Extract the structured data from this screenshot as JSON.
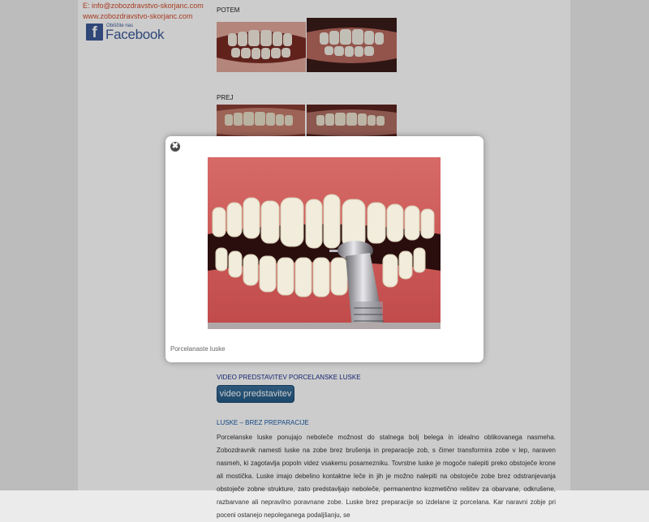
{
  "sidebar": {
    "email": "E: info@zobozdravstvo-skorjanc.com",
    "website": "www.zobozdravstvo-skorjanc.com",
    "facebook_small": "Obiščite nas",
    "facebook_word": "Facebook",
    "facebook_letter": "f"
  },
  "gallery": {
    "after_label": "POTEM",
    "before_label": "PREJ"
  },
  "lightbox": {
    "close_symbol": "✖",
    "caption": "Porcelanaste luske"
  },
  "video": {
    "heading": "VIDEO PREDSTAVITEV PORCELANSKE LUSKE",
    "button_label": "video predstavitev"
  },
  "article": {
    "heading": "LUSKE – BREZ PREPARACIJE",
    "paragraph": "Porcelanske luske ponujajo neboleče možnost do stalnega bolj belega in idealno oblikovanega nasmeha. Zobozdravnik namesti luske na zobe brez brušenja in preparacije zob, s čimer transformira zobe v lep, naraven nasmeh, ki zagotavlja popoln videz vsakemu posamezniku. Tovrstne luske je mogoče nalepiti preko obstoječe krone ali mostička. Luske imajo debelino kontaktne leče in jih je možno nalepiti na obstoječe zobe brez odstranjevanja obstoječe zobne strukture, zato predstavljajo neboleče, permanentno kozmetično rešitev za obarvane, odkrušene, razbarvane ali nepravilno poravnane zobe. Luske brez preparacije so izdelane iz porcelana. Kar naravni zobje pri poceni ostanejo nepoleganega podaljšanju, se"
  },
  "colors": {
    "link": "#d04a2a",
    "facebook": "#3b5998",
    "heading_blue": "#1a2d8c",
    "button": "#2e6591"
  }
}
